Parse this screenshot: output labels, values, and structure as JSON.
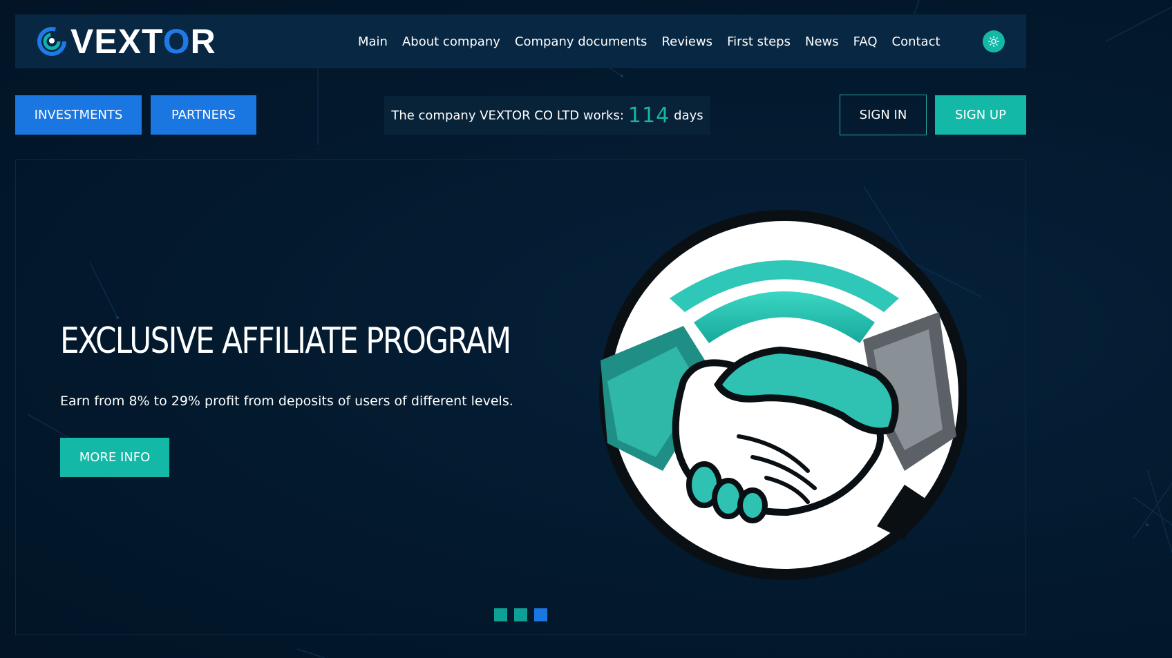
{
  "brand": {
    "name_main": "VEXT",
    "name_accent": "O",
    "name_end": "R",
    "accent_color": "#1f7ae8"
  },
  "nav": {
    "items": [
      {
        "label": "Main"
      },
      {
        "label": "About company"
      },
      {
        "label": "Company documents"
      },
      {
        "label": "Reviews"
      },
      {
        "label": "First steps"
      },
      {
        "label": "News"
      },
      {
        "label": "FAQ"
      },
      {
        "label": "Contact"
      }
    ],
    "theme_toggle_icon": "sun-icon"
  },
  "actions": {
    "investments_label": "INVESTMENTS",
    "partners_label": "PARTNERS",
    "sign_in_label": "SIGN IN",
    "sign_up_label": "SIGN UP"
  },
  "status": {
    "prefix": "The company VEXTOR CO LTD works:",
    "days": "114",
    "suffix": "days"
  },
  "hero": {
    "title": "EXCLUSIVE AFFILIATE PROGRAM",
    "subtitle": "Earn from 8% to 29% profit from deposits of users of different levels.",
    "button_label": "MORE INFO",
    "illustration_icon": "handshake-icon",
    "slides": [
      {
        "active": false,
        "color": "#0fa095"
      },
      {
        "active": false,
        "color": "#0fa095"
      },
      {
        "active": true,
        "color": "#1a76e0"
      }
    ]
  },
  "colors": {
    "background": "#03192d",
    "header": "#072742",
    "teal": "#14b8a6",
    "blue": "#1a76e0"
  }
}
